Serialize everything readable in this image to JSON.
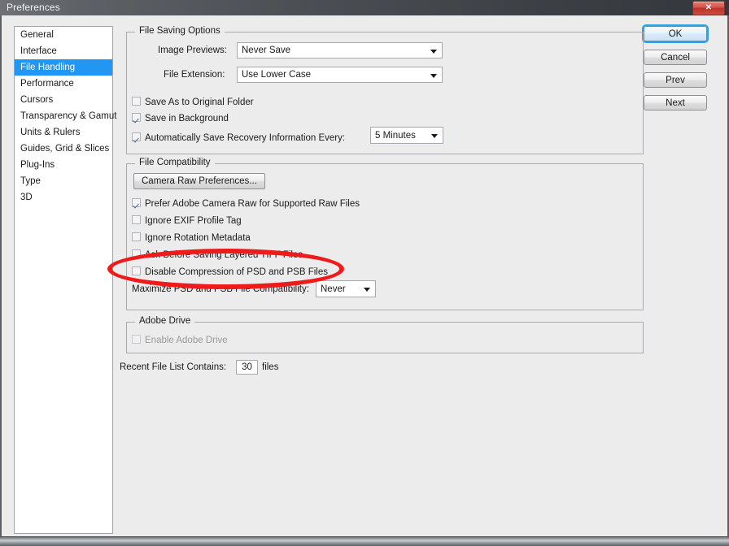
{
  "window": {
    "title": "Preferences",
    "close_label": "✕"
  },
  "sidebar": {
    "items": [
      {
        "label": "General",
        "selected": false
      },
      {
        "label": "Interface",
        "selected": false
      },
      {
        "label": "File Handling",
        "selected": true
      },
      {
        "label": "Performance",
        "selected": false
      },
      {
        "label": "Cursors",
        "selected": false
      },
      {
        "label": "Transparency & Gamut",
        "selected": false
      },
      {
        "label": "Units & Rulers",
        "selected": false
      },
      {
        "label": "Guides, Grid & Slices",
        "selected": false
      },
      {
        "label": "Plug-Ins",
        "selected": false
      },
      {
        "label": "Type",
        "selected": false
      },
      {
        "label": "3D",
        "selected": false
      }
    ]
  },
  "buttons": {
    "ok": "OK",
    "cancel": "Cancel",
    "prev": "Prev",
    "next": "Next"
  },
  "file_saving": {
    "legend": "File Saving Options",
    "image_previews_label": "Image Previews:",
    "image_previews_value": "Never Save",
    "file_extension_label": "File Extension:",
    "file_extension_value": "Use Lower Case",
    "save_as_original_label": "Save As to Original Folder",
    "save_as_original_checked": false,
    "save_background_label": "Save in Background",
    "save_background_checked": true,
    "autosave_label": "Automatically Save Recovery Information Every:",
    "autosave_checked": true,
    "autosave_value": "5 Minutes"
  },
  "file_compat": {
    "legend": "File Compatibility",
    "camera_raw_button": "Camera Raw Preferences...",
    "prefer_acr_label": "Prefer Adobe Camera Raw for Supported Raw Files",
    "prefer_acr_checked": true,
    "ignore_exif_label": "Ignore EXIF Profile Tag",
    "ignore_exif_checked": false,
    "ignore_rotation_label": "Ignore Rotation Metadata",
    "ignore_rotation_checked": false,
    "ask_tiff_label": "Ask Before Saving Layered TIFF Files",
    "ask_tiff_checked": false,
    "disable_compression_label": "Disable Compression of PSD and PSB Files",
    "disable_compression_checked": false,
    "maximize_label": "Maximize PSD and PSB File Compatibility:",
    "maximize_value": "Never"
  },
  "adobe_drive": {
    "legend": "Adobe Drive",
    "enable_label": "Enable Adobe Drive",
    "enable_checked": false
  },
  "recent_files": {
    "label": "Recent File List Contains:",
    "value": "30",
    "suffix": "files"
  },
  "colors": {
    "selection": "#2196f3",
    "annotation": "#ef1b1b",
    "close_button": "#bb3328"
  }
}
